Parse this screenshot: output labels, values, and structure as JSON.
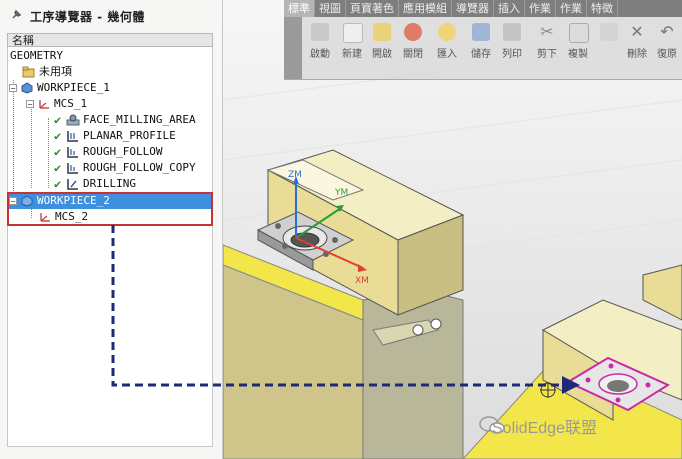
{
  "navigator": {
    "title": "工序導覽器 - 幾何體",
    "column_header": "名稱",
    "items": [
      {
        "label": "GEOMETRY"
      },
      {
        "label": "未用項"
      },
      {
        "label": "WORKPIECE_1"
      },
      {
        "label": "MCS_1"
      },
      {
        "label": "FACE_MILLING_AREA"
      },
      {
        "label": "PLANAR_PROFILE"
      },
      {
        "label": "ROUGH_FOLLOW"
      },
      {
        "label": "ROUGH_FOLLOW_COPY"
      },
      {
        "label": "DRILLING"
      },
      {
        "label": "WORKPIECE_2"
      },
      {
        "label": "MCS_2"
      }
    ]
  },
  "ribbon": {
    "tabs": [
      "標準",
      "視圖",
      "頁寶著色",
      "應用模組",
      "導覽器",
      "插入",
      "作業",
      "作業",
      "特徵"
    ],
    "buttons": [
      "啟動",
      "新建",
      "開啟",
      "關閉",
      "匯入",
      "儲存",
      "列印",
      "剪下",
      "複製",
      "",
      "刪除",
      "復原"
    ]
  },
  "viewport": {
    "axis_labels": {
      "zm": "ZM",
      "ym": "YM",
      "xm": "XM"
    }
  },
  "watermark": {
    "text": "SolidEdge联盟"
  },
  "colors": {
    "selection": "#3d8fe0",
    "highlight_box": "#c83232",
    "arrow": "#1e2a78",
    "part_yellow": "#e8dc96"
  }
}
